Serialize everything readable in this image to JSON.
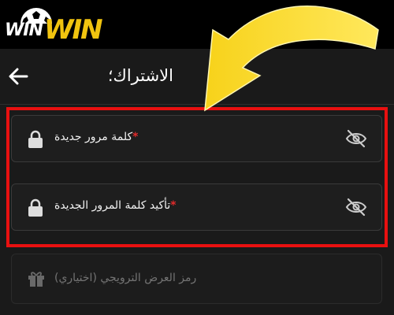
{
  "brand": {
    "part1": "WIN",
    "part2": "WIN"
  },
  "header": {
    "title": "الاشتراك؛"
  },
  "form": {
    "new_password_label": "كلمة مرور جديدة",
    "confirm_password_label": "تأكيد كلمة المرور الجديدة",
    "required_mark": "*",
    "promo_label": "رمز العرض الترويجي (اختياري)"
  },
  "colors": {
    "accent": "#f1c40f",
    "highlight": "#e81010",
    "required": "#e32b2b",
    "background": "#1a1a1a"
  },
  "icons": [
    "back-arrow-icon",
    "lock-icon",
    "eye-off-icon",
    "gift-icon",
    "soccer-ball-icon",
    "curved-arrow-annotation"
  ]
}
